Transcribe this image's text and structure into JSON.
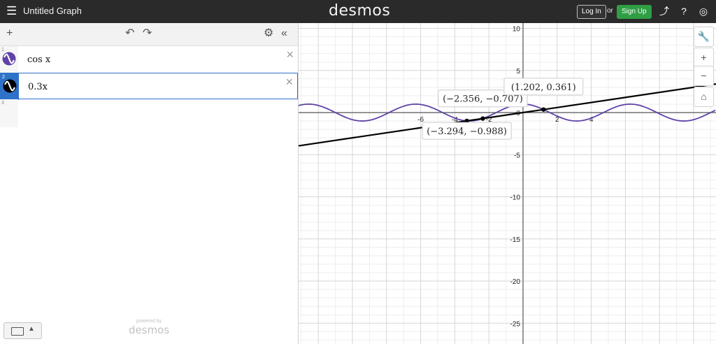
{
  "header": {
    "title": "Untitled Graph",
    "logo_text": "desmos",
    "login_label": "Log In",
    "or_text": "or",
    "signup_label": "Sign Up",
    "icons": [
      "menu-icon",
      "share-icon",
      "help-icon",
      "globe-icon"
    ]
  },
  "expressions": [
    {
      "number": "1",
      "latex": "cos x",
      "color": "#6042a6"
    },
    {
      "number": "2",
      "latex": "0.3x",
      "color": "#000000"
    },
    {
      "number": "3",
      "latex": "",
      "color": ""
    }
  ],
  "powered": {
    "line1": "powered by",
    "line2": "desmos"
  },
  "graph": {
    "x_ticks": [
      "-6",
      "-4",
      "-2",
      "2",
      "4"
    ],
    "y_ticks": [
      "10",
      "5",
      "0",
      "-5",
      "-10",
      "-15",
      "-20",
      "-25"
    ],
    "points": [
      {
        "x": -2.356,
        "y": -0.707,
        "label": "(−2.356, −0.707)"
      },
      {
        "x": -3.294,
        "y": -0.988,
        "label": "(−3.294, −0.988)"
      },
      {
        "x": 1.202,
        "y": 0.361,
        "label": "(1.202, 0.361)"
      }
    ],
    "cos_color": "#6042a6",
    "line_color": "#000000"
  }
}
